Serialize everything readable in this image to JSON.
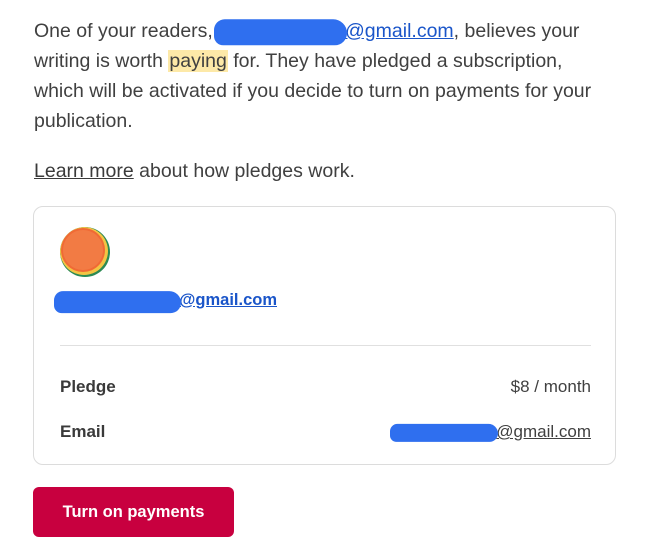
{
  "intro": {
    "part1": "One of your readers, ",
    "email_domain": "@gmail.com",
    "part2": ", believes your writing is worth ",
    "highlight": "paying",
    "part3": " for. They have pledged a subscription, which will be activated if you decide to turn on payments for your publication."
  },
  "learn": {
    "link": "Learn more",
    "rest": " about how pledges work."
  },
  "card": {
    "email_domain": "@gmail.com",
    "pledge_label": "Pledge",
    "pledge_value": "$8 / month",
    "email_label": "Email",
    "email_value_domain": "@gmail.com"
  },
  "button": {
    "label": "Turn on payments"
  },
  "colors": {
    "accent": "#c8003f",
    "link": "#1a55c9",
    "highlight": "#fde9a8",
    "redaction": "#2f6fef"
  }
}
